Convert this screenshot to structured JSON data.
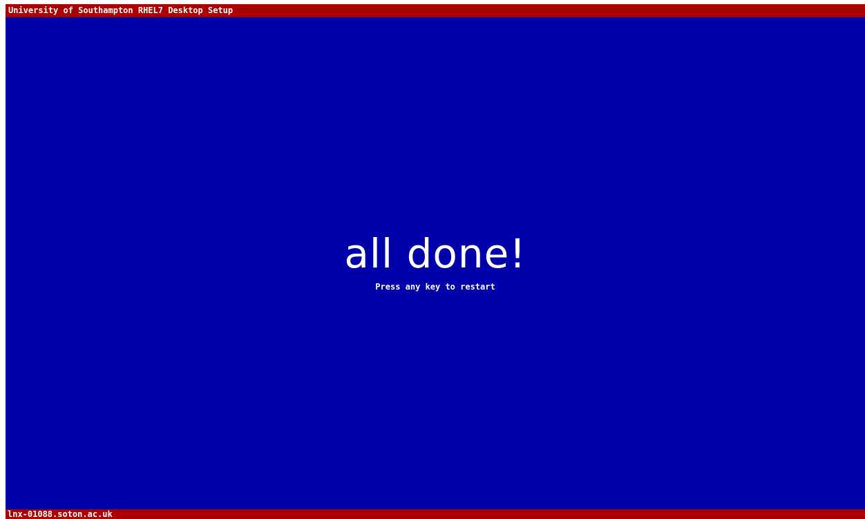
{
  "header": {
    "title": "University of Southampton RHEL7 Desktop Setup"
  },
  "main": {
    "message": "all done!",
    "prompt": "Press any key to restart"
  },
  "footer": {
    "hostname": "lnx-01088.soton.ac.uk"
  },
  "colors": {
    "background": "#0000aa",
    "bars": "#aa0000",
    "text": "#ffffff"
  }
}
